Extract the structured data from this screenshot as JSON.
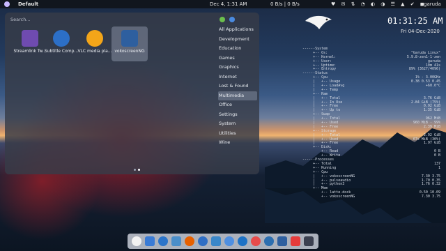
{
  "topbar": {
    "title": "Default",
    "clock": "Dec 4, 1:31 AM",
    "network": "0 B/s  |  0 B/s",
    "tray_icons": "♥ ✉ ⇅ ◔ ◐ ◑ ☰ ▲ ✔ ◼",
    "user": "garuda"
  },
  "launcher": {
    "search_placeholder": "Search...",
    "apps": [
      {
        "label": "Streamlink Tw...",
        "icon": "streamlink-twitch-icon",
        "color": "#6f4bb0"
      },
      {
        "label": "Subtitle Comp...",
        "icon": "subtitle-composer-icon",
        "color": "#2c6fc7"
      },
      {
        "label": "VLC media pla...",
        "icon": "vlc-icon",
        "color": "#f3a519"
      },
      {
        "label": "vokoscreenNG",
        "icon": "vokoscreen-icon",
        "color": "#2e5f9f",
        "selected": true
      }
    ],
    "categories": [
      "All Applications",
      "Development",
      "Education",
      "Games",
      "Graphics",
      "Internet",
      "Lost & Found",
      "Multimedia",
      "Office",
      "Settings",
      "System",
      "Utilities",
      "Wine"
    ],
    "active_category": "Multimedia"
  },
  "conky": {
    "time": "01:31:25 AM",
    "date": "Fri 04-Dec-2020",
    "rows": [
      {
        "k": "  ------System",
        "v": ""
      },
      {
        "k": "       +-- Os:",
        "v": "\"Garuda Linux\""
      },
      {
        "k": "       +-- Kernel:",
        "v": "5.9.8-zen1-1-zen"
      },
      {
        "k": "       +-- User:",
        "v": "garuda"
      },
      {
        "k": "       +-- Uptime:",
        "v": "10m 41s"
      },
      {
        "k": "       +-- Entropy",
        "v": "89% (3627/4096)"
      },
      {
        "k": "  ------Status",
        "v": ""
      },
      {
        "k": "       +-- Cpu",
        "v": "1% - 3.00GHz"
      },
      {
        "k": "       |   +-- Usage",
        "v": "0.38 0.53 0.45"
      },
      {
        "k": "       |   +-- LoadAvg",
        "v": "+60.0°C"
      },
      {
        "k": "       |   +-- Temp",
        "v": ""
      },
      {
        "k": "       +-- Ram",
        "v": ""
      },
      {
        "k": "       |   +-- Total",
        "v": "3.76 GiB"
      },
      {
        "k": "       |   +-- In Use",
        "v": "2.84 GiB (75%)"
      },
      {
        "k": "       |   +-- Free",
        "v": "0.92 GiB"
      },
      {
        "k": "       |   +-- Up to",
        "v": "1.35 GiB"
      },
      {
        "k": "       +-- Swap",
        "v": ""
      },
      {
        "k": "       |   +-- Total",
        "v": "962 MiB"
      },
      {
        "k": "       |   +-- Used",
        "v": "960 MiB - 99%"
      },
      {
        "k": "       |   +-- Free",
        "v": "2.39 MiB"
      },
      {
        "k": "       +-- Storage",
        "v": ""
      },
      {
        "k": "       |   +-- Total",
        "v": "2.92 GiB"
      },
      {
        "k": "       |   +-- Used",
        "v": "67s MiB (30%)"
      },
      {
        "k": "       |   +-- Free",
        "v": "1.97 GiB"
      },
      {
        "k": "       +-- Disk:",
        "v": ""
      },
      {
        "k": "           +-- Read",
        "v": "0 B"
      },
      {
        "k": "           +-- Write",
        "v": "0 B"
      },
      {
        "k": "  ------Processes",
        "v": ""
      },
      {
        "k": "       +-- Total",
        "v": "137"
      },
      {
        "k": "       +-- Running",
        "v": "1"
      },
      {
        "k": "       +-- Cpu",
        "v": ""
      },
      {
        "k": "       |   +-- vokoscreenNG",
        "v": "7.30   3.75"
      },
      {
        "k": "       |   +-- pulseaudio",
        "v": "1.70   0.35"
      },
      {
        "k": "       |   +-- python3",
        "v": "1.76   0.32"
      },
      {
        "k": "       +-- Mem",
        "v": ""
      },
      {
        "k": "           +-- latte-dock",
        "v": "0.50  10.09"
      },
      {
        "k": "           +-- vokoscreenNG",
        "v": "7.30   3.75"
      }
    ]
  },
  "dock": {
    "items": [
      {
        "icon": "garuda-eagle-icon",
        "color": "#f2f2f2"
      },
      {
        "icon": "desktop-icon",
        "color": "#3a7bd5"
      },
      {
        "icon": "file-manager-icon",
        "color": "#2b74c9"
      },
      {
        "icon": "settings-icon",
        "color": "#4a8ec9"
      },
      {
        "icon": "firefox-icon",
        "color": "#e66000"
      },
      {
        "icon": "thunderbird-icon",
        "color": "#2f6ec4"
      },
      {
        "icon": "downloads-icon",
        "color": "#3a87c9"
      },
      {
        "icon": "kdeconnect-icon",
        "color": "#4f8fe0"
      },
      {
        "icon": "clock-icon",
        "color": "#1e72c5"
      },
      {
        "icon": "spotify-icon",
        "color": "#e64c4c"
      },
      {
        "icon": "camera-icon",
        "color": "#2d6fb0"
      },
      {
        "icon": "vokoscreen-icon",
        "color": "#2e5f9f"
      },
      {
        "icon": "pdf-viewer-icon",
        "color": "#e53b3b"
      },
      {
        "icon": "menu-icon",
        "color": "#3b4050"
      }
    ]
  }
}
